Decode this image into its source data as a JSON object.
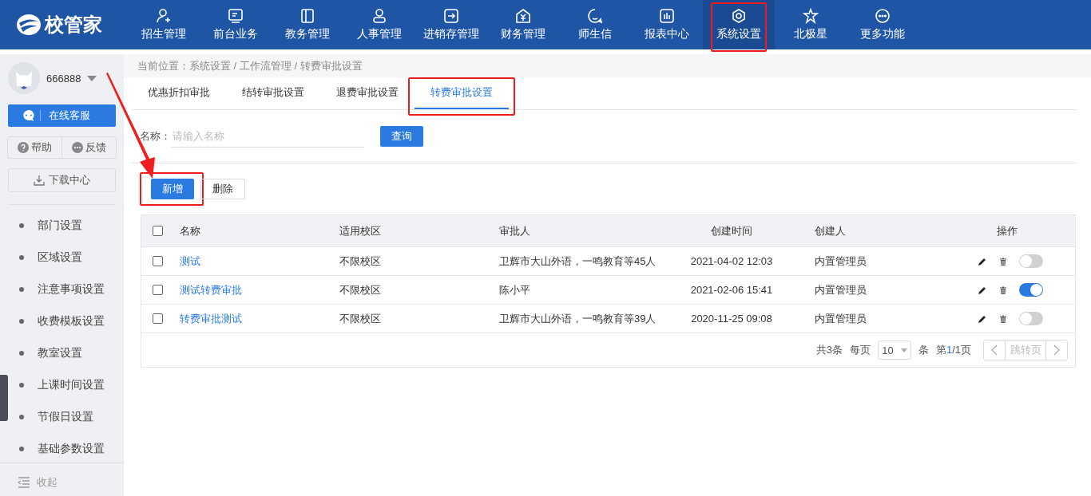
{
  "logo": {
    "text": "校管家"
  },
  "nav": [
    {
      "label": "招生管理",
      "selected": false,
      "highlighted": false
    },
    {
      "label": "前台业务",
      "selected": false,
      "highlighted": false
    },
    {
      "label": "教务管理",
      "selected": false,
      "highlighted": false
    },
    {
      "label": "人事管理",
      "selected": false,
      "highlighted": false
    },
    {
      "label": "进销存管理",
      "selected": false,
      "highlighted": false
    },
    {
      "label": "财务管理",
      "selected": false,
      "highlighted": false
    },
    {
      "label": "师生信",
      "selected": false,
      "highlighted": false
    },
    {
      "label": "报表中心",
      "selected": false,
      "highlighted": false
    },
    {
      "label": "系统设置",
      "selected": true,
      "highlighted": true
    },
    {
      "label": "北极星",
      "selected": false,
      "highlighted": false
    },
    {
      "label": "更多功能",
      "selected": false,
      "highlighted": false
    }
  ],
  "sidebar": {
    "username": "666888",
    "service_button": "在线客服",
    "help": "帮助",
    "feedback": "反馈",
    "download": "下载中心",
    "items": [
      {
        "label": "部门设置"
      },
      {
        "label": "区域设置"
      },
      {
        "label": "注意事项设置"
      },
      {
        "label": "收费模板设置"
      },
      {
        "label": "教室设置"
      },
      {
        "label": "上课时间设置"
      },
      {
        "label": "节假日设置"
      },
      {
        "label": "基础参数设置"
      }
    ],
    "collapse": "收起"
  },
  "breadcrumb": "当前位置：系统设置 / 工作流管理 / 转费审批设置",
  "tabs": [
    {
      "label": "优惠折扣审批",
      "selected": false,
      "highlighted": false
    },
    {
      "label": "结转审批设置",
      "selected": false,
      "highlighted": false
    },
    {
      "label": "退费审批设置",
      "selected": false,
      "highlighted": false
    },
    {
      "label": "转费审批设置",
      "selected": true,
      "highlighted": true
    }
  ],
  "search": {
    "label": "名称：",
    "placeholder": "请输入名称",
    "button": "查询"
  },
  "actions": [
    {
      "label": "新增",
      "kind": "primary",
      "highlighted": true
    },
    {
      "label": "删除",
      "kind": "plain",
      "highlighted": false
    }
  ],
  "table": {
    "select_all": false,
    "columns": [
      "名称",
      "适用校区",
      "审批人",
      "创建时间",
      "创建人",
      "操作"
    ],
    "rows": [
      {
        "checked": false,
        "name": "测试",
        "campus": "不限校区",
        "approver": "卫辉市大山外语，一鸣教育等45人",
        "created": "2021-04-02 12:03",
        "creator": "内置管理员",
        "on": false
      },
      {
        "checked": false,
        "name": "测试转费审批",
        "campus": "不限校区",
        "approver": "陈小平",
        "created": "2021-02-06 15:41",
        "creator": "内置管理员",
        "on": true
      },
      {
        "checked": false,
        "name": "转费审批测试",
        "campus": "不限校区",
        "approver": "卫辉市大山外语，一鸣教育等39人",
        "created": "2020-11-25 09:08",
        "creator": "内置管理员",
        "on": false
      }
    ]
  },
  "pagination": {
    "total": "共3条",
    "per_page_label": "每页",
    "per_page": "10",
    "unit": "条",
    "page_prefix": "第",
    "page_current": "1",
    "page_rest": "/1页",
    "jump": "跳转页"
  }
}
